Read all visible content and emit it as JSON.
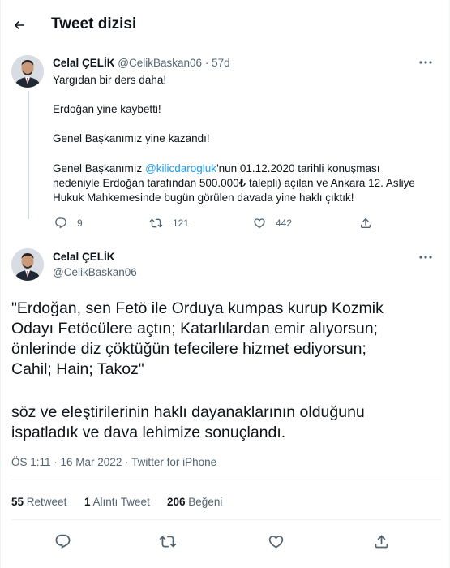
{
  "header": {
    "title": "Tweet dizisi"
  },
  "tweet1": {
    "name": "Celal ÇELİK",
    "handle": "@CelikBaskan06",
    "time": "· 57d",
    "lines": [
      "Yargıdan bir ders daha!",
      "Erdoğan yine kaybetti!",
      "Genel Başkanımız yine kazandı!"
    ],
    "para_prefix": "Genel Başkanımız ",
    "mention": "@kilicdarogluk",
    "para_rest_1": "'nun 01.12.2020 tarihli konuşması",
    "para_line_2": "nedeniyle Erdoğan tarafından 500.000₺ talepli) açılan ve Ankara 12. Asliye",
    "para_line_3": "Hukuk Mahkemesinde bugün görülen davada yine haklı çıktık!",
    "replies": "9",
    "retweets": "121",
    "likes": "442"
  },
  "tweet2": {
    "name": "Celal ÇELİK",
    "handle": "@CelikBaskan06",
    "quote_lines": [
      "\"Erdoğan, sen Fetö ile Orduya kumpas kurup Kozmik",
      "Odayı Fetöcülere açtın; Katarlılardan  emir alıyorsun;",
      "önlerinde diz çöktüğün tefecilere hizmet ediyorsun;",
      "Cahil; Hain; Takoz\""
    ],
    "body_lines": [
      "söz ve eleştirilerinin haklı dayanaklarının olduğunu",
      "ispatladık ve dava lehimize sonuçlandı."
    ],
    "meta": "ÖS 1:11 · 16 Mar 2022 · Twitter for iPhone",
    "retweet_count": "55",
    "retweet_label": "Retweet",
    "quote_count": "1",
    "quote_label": "Alıntı Tweet",
    "like_count": "206",
    "like_label": "Beğeni"
  },
  "icons": {
    "back": "back-arrow-icon",
    "more": "more-icon",
    "reply": "reply-icon",
    "retweet": "retweet-icon",
    "like": "heart-icon",
    "share": "share-icon"
  },
  "colors": {
    "accent": "#1d9bf0",
    "muted": "#536471",
    "text": "#0f1419"
  }
}
